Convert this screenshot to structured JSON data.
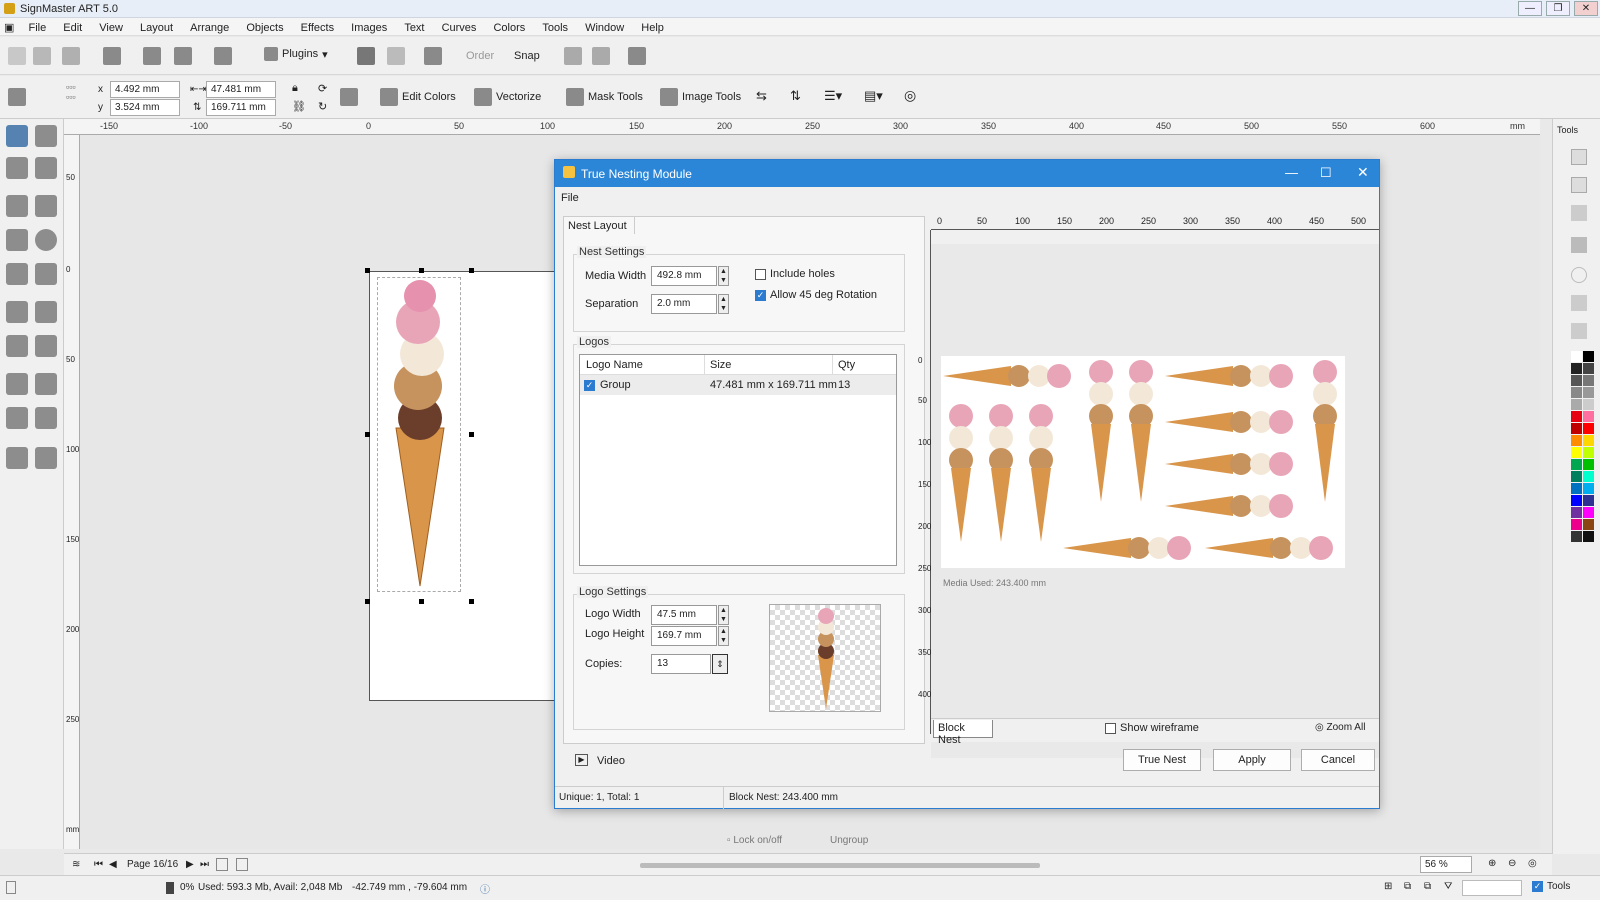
{
  "app": {
    "title": "SignMaster ART 5.0"
  },
  "menu": [
    "File",
    "Edit",
    "View",
    "Layout",
    "Arrange",
    "Objects",
    "Effects",
    "Images",
    "Text",
    "Curves",
    "Colors",
    "Tools",
    "Window",
    "Help"
  ],
  "toolbar": {
    "plugins": "Plugins",
    "order": "Order",
    "snap": "Snap"
  },
  "props": {
    "x": "4.492 mm",
    "y": "3.524 mm",
    "w": "47.481 mm",
    "h": "169.711 mm",
    "edit_colors": "Edit Colors",
    "vectorize": "Vectorize",
    "mask_tools": "Mask Tools",
    "image_tools": "Image Tools"
  },
  "ruler": {
    "h_ticks": [
      "-150",
      "-100",
      "-50",
      "0",
      "50",
      "100",
      "150",
      "200",
      "250",
      "300",
      "350",
      "400",
      "450",
      "500",
      "550",
      "600"
    ],
    "unit": "mm",
    "v_ticks": [
      "50",
      "0",
      "50",
      "100",
      "150",
      "200",
      "250"
    ],
    "v_unit": "mm"
  },
  "right_panel": {
    "tools_tab": "Tools"
  },
  "dialog": {
    "title": "True Nesting Module",
    "menu_file": "File",
    "tab": "Nest Layout",
    "nest_settings": {
      "label": "Nest Settings",
      "media_width_label": "Media Width",
      "media_width": "492.8 mm",
      "separation_label": "Separation",
      "separation": "2.0 mm",
      "include_holes": "Include holes",
      "allow_rotation": "Allow 45 deg Rotation"
    },
    "logos": {
      "label": "Logos",
      "columns": [
        "Logo Name",
        "Size",
        "Qty"
      ],
      "rows": [
        {
          "name": "Group",
          "size": "47.481 mm x 169.711 mm",
          "qty": "13"
        }
      ]
    },
    "logo_settings": {
      "label": "Logo Settings",
      "width_label": "Logo Width",
      "width": "47.5 mm",
      "height_label": "Logo Height",
      "height": "169.7 mm",
      "copies_label": "Copies:",
      "copies": "13"
    },
    "preview_ruler": {
      "h": [
        "0",
        "50",
        "100",
        "150",
        "200",
        "250",
        "300",
        "350",
        "400",
        "450",
        "500"
      ],
      "v": [
        "0",
        "50",
        "100",
        "150",
        "200",
        "250",
        "300",
        "350",
        "400"
      ]
    },
    "media_used": "Media Used: 243.400 mm",
    "block_nest_tab": "Block Nest",
    "show_wireframe": "Show wireframe",
    "zoom_all": "Zoom All",
    "video": "Video",
    "buttons": {
      "true_nest": "True Nest",
      "apply": "Apply",
      "cancel": "Cancel"
    },
    "status_left": "Unique: 1, Total: 1",
    "status_right": "Block Nest: 243.400 mm"
  },
  "bottom": {
    "lock": "Lock on/off",
    "ungroup": "Ungroup",
    "page": "Page 16/16",
    "zoom": "56 %"
  },
  "status": {
    "percent": "0%",
    "memory": "Used: 593.3 Mb, Avail: 2,048 Mb",
    "coords": "-42.749 mm , -79.604 mm",
    "tools": "Tools"
  }
}
